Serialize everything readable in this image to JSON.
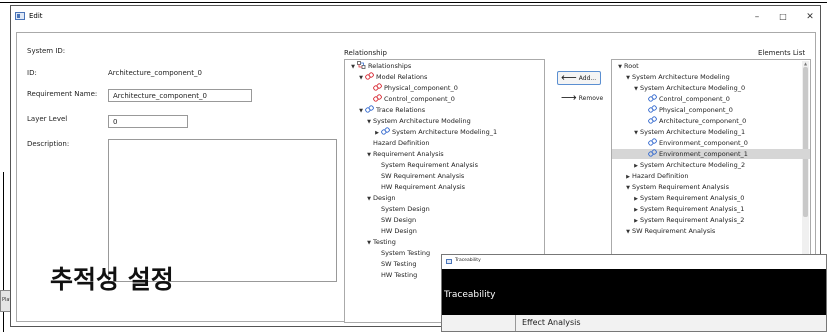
{
  "background_window": {
    "title": "Plat"
  },
  "edit_window": {
    "title": "Edit",
    "controls": {
      "minimize": "–",
      "maximize": "□",
      "close": "✕"
    }
  },
  "form": {
    "system_id_label": "System ID:",
    "id_label": "ID:",
    "id_value": "Architecture_component_0",
    "requirement_name_label": "Requirement Name:",
    "requirement_name_value": "Architecture_component_0",
    "layer_level_label": "Layer Level",
    "layer_level_value": "0",
    "description_label": "Description:"
  },
  "relationship": {
    "title": "Relationship",
    "items": [
      {
        "text": "Relationships",
        "indent": 0,
        "arrow": "down",
        "icon": "relationship-icon"
      },
      {
        "text": "Model Relations",
        "indent": 1,
        "arrow": "down",
        "icon": "link-red-icon"
      },
      {
        "text": "Physical_component_0",
        "indent": 3,
        "arrow": "",
        "icon": "link-red-icon"
      },
      {
        "text": "Control_component_0",
        "indent": 3,
        "arrow": "",
        "icon": "link-red-icon"
      },
      {
        "text": "Trace Relations",
        "indent": 1,
        "arrow": "down",
        "icon": "link-blue-icon"
      },
      {
        "text": "System Architecture Modeling",
        "indent": 2,
        "arrow": "down",
        "icon": ""
      },
      {
        "text": "System Architecture Modeling_1",
        "indent": 3,
        "arrow": "right",
        "icon": "link-blue-icon"
      },
      {
        "text": "Hazard Definition",
        "indent": 3,
        "arrow": "",
        "icon": ""
      },
      {
        "text": "Requirement Analysis",
        "indent": 2,
        "arrow": "down",
        "icon": ""
      },
      {
        "text": "System Requirement Analysis",
        "indent": 4,
        "arrow": "",
        "icon": ""
      },
      {
        "text": "SW Requirement Analysis",
        "indent": 4,
        "arrow": "",
        "icon": ""
      },
      {
        "text": "HW Requirement Analysis",
        "indent": 4,
        "arrow": "",
        "icon": ""
      },
      {
        "text": "Design",
        "indent": 2,
        "arrow": "down",
        "icon": ""
      },
      {
        "text": "System Design",
        "indent": 4,
        "arrow": "",
        "icon": ""
      },
      {
        "text": "SW Design",
        "indent": 4,
        "arrow": "",
        "icon": ""
      },
      {
        "text": "HW Design",
        "indent": 4,
        "arrow": "",
        "icon": ""
      },
      {
        "text": "Testing",
        "indent": 2,
        "arrow": "down",
        "icon": ""
      },
      {
        "text": "System Testing",
        "indent": 4,
        "arrow": "",
        "icon": ""
      },
      {
        "text": "SW Testing",
        "indent": 4,
        "arrow": "",
        "icon": ""
      },
      {
        "text": "HW Testing",
        "indent": 4,
        "arrow": "",
        "icon": ""
      }
    ]
  },
  "buttons": {
    "add": "Add...",
    "remove": "Remove",
    "add_arrow": "⟵",
    "remove_arrow": "⟶"
  },
  "elements_list": {
    "title": "Elements List",
    "items": [
      {
        "text": "Root",
        "indent": 0,
        "arrow": "down",
        "icon": ""
      },
      {
        "text": "System Architecture Modeling",
        "indent": 1,
        "arrow": "down",
        "icon": ""
      },
      {
        "text": "System Architecture Modeling_0",
        "indent": 2,
        "arrow": "down",
        "icon": ""
      },
      {
        "text": "Control_component_0",
        "indent": 4,
        "arrow": "",
        "icon": "link-blue-icon"
      },
      {
        "text": "Physical_component_0",
        "indent": 4,
        "arrow": "",
        "icon": "link-blue-icon"
      },
      {
        "text": "Architecture_component_0",
        "indent": 4,
        "arrow": "",
        "icon": "link-blue-icon"
      },
      {
        "text": "System Architecture Modeling_1",
        "indent": 2,
        "arrow": "down",
        "icon": ""
      },
      {
        "text": "Environment_component_0",
        "indent": 4,
        "arrow": "",
        "icon": "link-blue-icon"
      },
      {
        "text": "Environment_component_1",
        "indent": 4,
        "arrow": "",
        "icon": "link-blue-icon",
        "selected": true
      },
      {
        "text": "System Architecture Modeling_2",
        "indent": 2,
        "arrow": "right",
        "icon": ""
      },
      {
        "text": "Hazard Definition",
        "indent": 1,
        "arrow": "right",
        "icon": ""
      },
      {
        "text": "System Requirement Analysis",
        "indent": 1,
        "arrow": "down",
        "icon": ""
      },
      {
        "text": "System Requirement Analysis_0",
        "indent": 2,
        "arrow": "right",
        "icon": ""
      },
      {
        "text": "System Requirement Analysis_1",
        "indent": 2,
        "arrow": "right",
        "icon": ""
      },
      {
        "text": "System Requirement Analysis_2",
        "indent": 2,
        "arrow": "right",
        "icon": ""
      },
      {
        "text": "SW Requirement Analysis",
        "indent": 1,
        "arrow": "down",
        "icon": ""
      }
    ]
  },
  "overlay_caption": "추적성 설정",
  "traceability_window": {
    "window_title": "Traceability",
    "heading": "Traceability",
    "item": "Effect Analysis"
  },
  "colors": {
    "link_red": "#d9303a",
    "link_blue": "#3b6fd0",
    "selected_row": "#d6d6d6",
    "header_black": "#000000"
  }
}
